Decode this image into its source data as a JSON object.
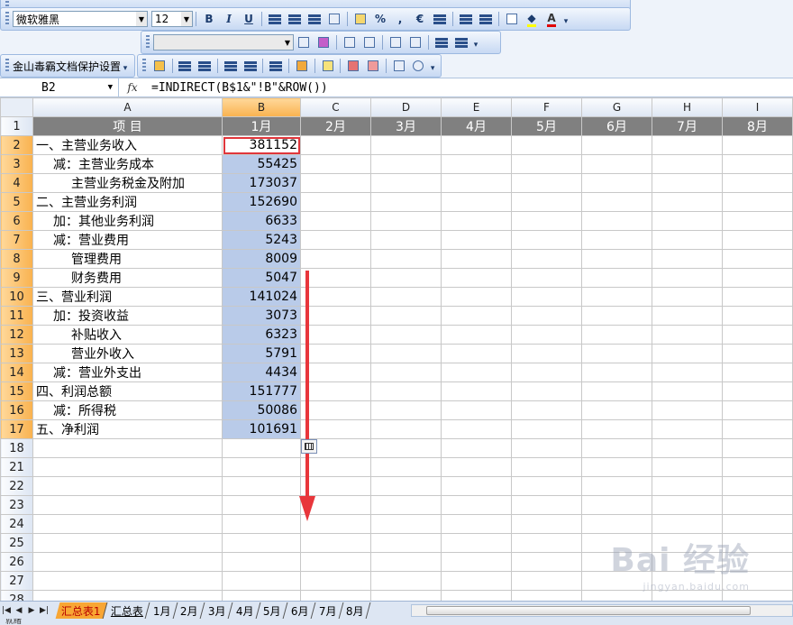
{
  "toolbar": {
    "font_name": "微软雅黑",
    "font_size": "12",
    "bold": "B",
    "italic": "I",
    "underline": "U",
    "percent": "%",
    "comma": ",",
    "euro": "€",
    "font_color_letter": "A",
    "plugin_label": "金山毒霸文档保护设置"
  },
  "formula_bar": {
    "cell_ref": "B2",
    "fx": "fx",
    "formula": "=INDIRECT(B$1&\"!B\"&ROW())"
  },
  "columns": [
    "A",
    "B",
    "C",
    "D",
    "E",
    "F",
    "G",
    "H",
    "I"
  ],
  "header_row": {
    "row": "1",
    "cells": [
      "项    目",
      "1月",
      "2月",
      "3月",
      "4月",
      "5月",
      "6月",
      "7月",
      "8月"
    ]
  },
  "rows": [
    {
      "row": "2",
      "item": "一、主营业务收入",
      "value": "381152",
      "indent": 0
    },
    {
      "row": "3",
      "item": "减：主营业务成本",
      "value": "55425",
      "indent": 1
    },
    {
      "row": "4",
      "item": "主营业务税金及附加",
      "value": "173037",
      "indent": 2
    },
    {
      "row": "5",
      "item": "二、主营业务利润",
      "value": "152690",
      "indent": 0
    },
    {
      "row": "6",
      "item": "加：其他业务利润",
      "value": "6633",
      "indent": 1
    },
    {
      "row": "7",
      "item": "减：营业费用",
      "value": "5243",
      "indent": 1
    },
    {
      "row": "8",
      "item": "管理费用",
      "value": "8009",
      "indent": 2
    },
    {
      "row": "9",
      "item": "财务费用",
      "value": "5047",
      "indent": 2
    },
    {
      "row": "10",
      "item": "三、营业利润",
      "value": "141024",
      "indent": 0
    },
    {
      "row": "11",
      "item": "加：投资收益",
      "value": "3073",
      "indent": 1
    },
    {
      "row": "12",
      "item": "补贴收入",
      "value": "6323",
      "indent": 2
    },
    {
      "row": "13",
      "item": "营业外收入",
      "value": "5791",
      "indent": 2
    },
    {
      "row": "14",
      "item": "减：营业外支出",
      "value": "4434",
      "indent": 1
    },
    {
      "row": "15",
      "item": "四、利润总额",
      "value": "151777",
      "indent": 0
    },
    {
      "row": "16",
      "item": "减：所得税",
      "value": "50086",
      "indent": 1
    },
    {
      "row": "17",
      "item": "五、净利润",
      "value": "101691",
      "indent": 0
    }
  ],
  "empty_rows": [
    "18",
    "21",
    "22",
    "23",
    "24",
    "25",
    "26",
    "27",
    "28"
  ],
  "sheet_tabs": [
    {
      "label": "汇总表1",
      "active": true
    },
    {
      "label": "汇总表",
      "active": false
    },
    {
      "label": "1月",
      "active": false
    },
    {
      "label": "2月",
      "active": false
    },
    {
      "label": "3月",
      "active": false
    },
    {
      "label": "4月",
      "active": false
    },
    {
      "label": "5月",
      "active": false
    },
    {
      "label": "6月",
      "active": false
    },
    {
      "label": "7月",
      "active": false
    },
    {
      "label": "8月",
      "active": false
    }
  ],
  "status_text": "就绪",
  "watermark": {
    "brand": "Bai 经验",
    "url": "jingyan.baidu.com"
  },
  "colors": {
    "accent": "#f8a634",
    "selection": "#b9cbe9",
    "active_border": "#e0363b",
    "header_fill": "#808080",
    "arrow": "#e8363b"
  }
}
